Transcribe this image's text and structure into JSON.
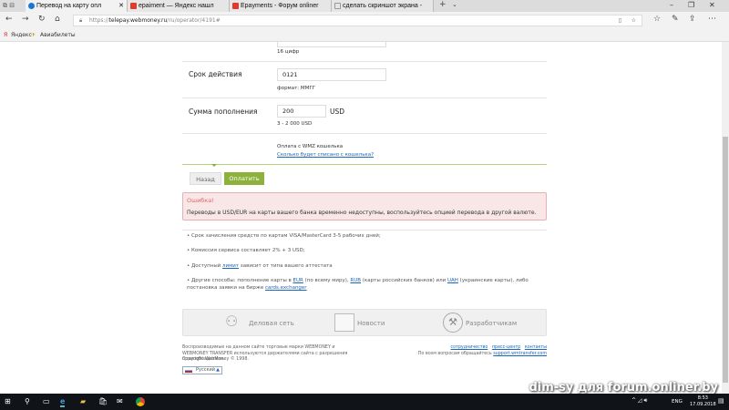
{
  "browser": {
    "tabs": [
      {
        "label": "Перевод на карту опл",
        "active": true,
        "color": "#1a78d0"
      },
      {
        "label": "epaiment — Яндекс нашл",
        "active": false,
        "color": "#e03a2a"
      },
      {
        "label": "Epayments - Форум onliner",
        "active": false,
        "color": "#e03a2a"
      },
      {
        "label": "сделать скриншот экрана -",
        "active": false,
        "color": "#999999"
      }
    ],
    "url_prefix": "https://",
    "url_domain": "telepay.webmoney.ru",
    "url_path": "/ru/operator/4191#",
    "favorites": [
      "Яндекс",
      "Авиабилеты"
    ]
  },
  "form": {
    "card_hint": "16 цифр",
    "expiry_label": "Срок действия",
    "expiry_value": "0121",
    "expiry_hint": "формат: ММГГ",
    "amount_label": "Сумма пополнения",
    "amount_value": "200",
    "amount_currency": "USD",
    "amount_hint": "3 - 2 000 USD",
    "wallet_text": "Оплата с WMZ кошелька",
    "wallet_link": "Сколько будет списано с кошелька?",
    "back_button": "Назад",
    "pay_button": "Оплатить"
  },
  "error": {
    "title": "Ошибка!",
    "message": "Переводы в USD/EUR на карты вашего банка временно недоступны, воспользуйтесь опцией перевода в другой валюте."
  },
  "info": {
    "b1": "Срок зачисления средств по картам VISA/MasterCard 3-5 рабочих дней;",
    "b2": "Комиссия сервиса составляет 2% + 3 USD;",
    "b3_pre": "Доступный ",
    "b3_link": "лимит",
    "b3_post": " зависит от типа вашего аттестата",
    "b4_pre": "Другие способы: пополнение карты в ",
    "b4_eur": "EUR",
    "b4_mid1": " (по всему миру), ",
    "b4_rub": "RUB",
    "b4_mid2": " (карты российских банков) или ",
    "b4_uah": "UAH",
    "b4_mid3": " (украинские карты), либо постановка заявки на бирже ",
    "b4_ex": "cards.exchanger"
  },
  "footer": {
    "panel": [
      "Деловая сеть",
      "Новости",
      "Разработчикам"
    ],
    "legal": "Воспроизводимые на данном сайте торговые марки WEBMONEY и WEBMONEY TRANSFER используются держателями сайта с разрешения правообладателя.",
    "copyright": "Copyright WebMoney © 1998.",
    "links": [
      "сотрудничество",
      "пресс-центр",
      "контакты"
    ],
    "support_text": "По всем вопросам обращайтесь ",
    "support_link": "support.wmtransfer.com",
    "language": "Русский"
  },
  "taskbar": {
    "lang": "ENG",
    "time": "8:53",
    "date": "17.09.2018"
  },
  "watermark": "dim-sy для forum.onliner.by"
}
